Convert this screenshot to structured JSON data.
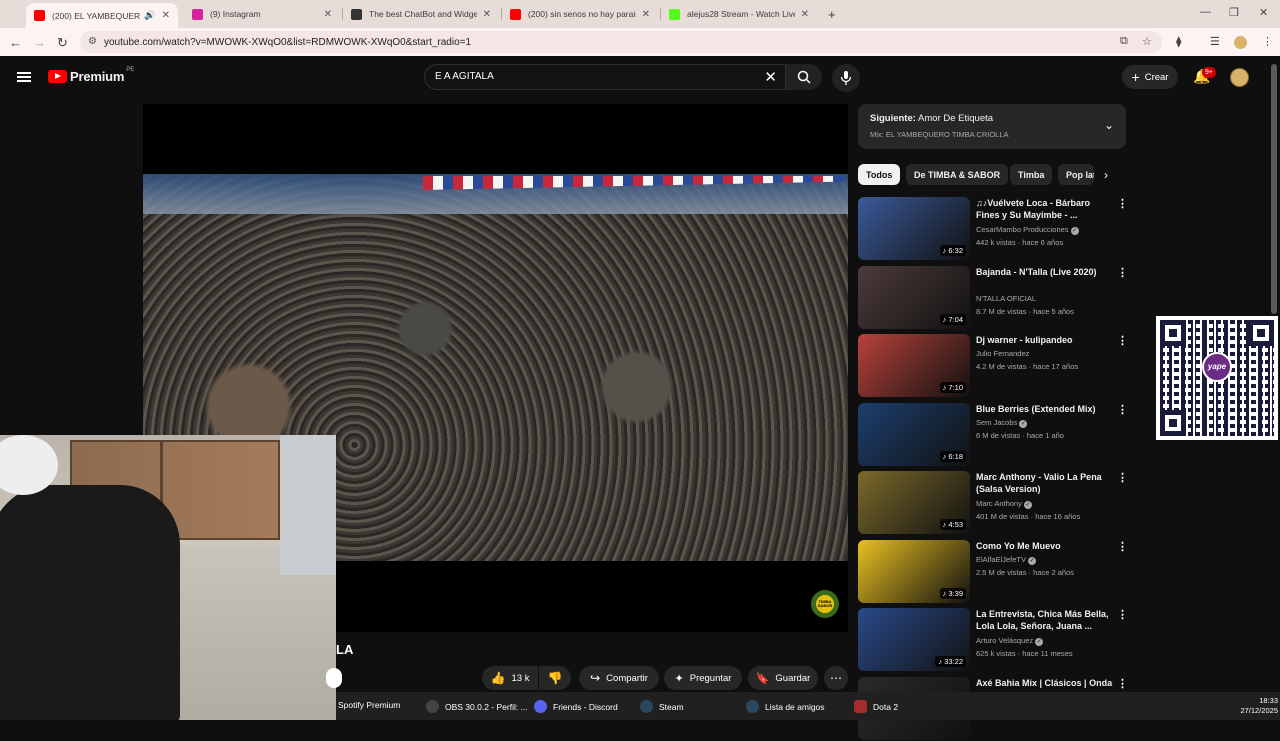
{
  "browser": {
    "tabs": [
      {
        "title": "(200) EL YAMBEQUERO TIMBA CRIOLLA",
        "favicon_color": "#ff0000",
        "active": true
      },
      {
        "title": "(9) Instagram",
        "favicon_color": "#d6249f",
        "active": false
      },
      {
        "title": "The best ChatBot and Widgets",
        "favicon_color": "#333333",
        "active": false
      },
      {
        "title": "(200) sin senos no hay paraiso",
        "favicon_color": "#ff0000",
        "active": false
      },
      {
        "title": "alejus28 Stream - Watch Live on Kick",
        "favicon_color": "#53fc18",
        "active": false
      }
    ],
    "new_tab": "+",
    "url": "youtube.com/watch?v=MWOWK-XWqO0&list=RDMWOWK-XWqO0&start_radio=1"
  },
  "youtube": {
    "logo_text": "Premium",
    "country_code": "PE",
    "search_value": "E A AGITALA",
    "create_label": "Crear",
    "notif_count": "9+",
    "video_title_fragment": "LA",
    "watermark": "TIMBA SABOR",
    "actions": {
      "likes": "13 k",
      "share": "Compartir",
      "ask": "Preguntar",
      "save": "Guardar"
    },
    "up_next": {
      "label": "Siguiente:",
      "title": "Amor De Etiqueta",
      "mix": "Mix: EL YAMBEQUERO TIMBA CRIOLLA"
    },
    "chips": [
      "Todos",
      "De TIMBA & SABOR",
      "Timba",
      "Pop latino"
    ],
    "recommendations": [
      {
        "title": "♫♪Vuélvete Loca - Bárbaro Fines y Su Mayimbe - ...",
        "channel": "CesarMambo Producciones",
        "verified": true,
        "meta": "442 k vistas · hace 6 años",
        "duration": "6:32",
        "thumb_color": "#3a5a9a"
      },
      {
        "title": "Bajanda -  N'Talla (Live 2020)",
        "channel": "N'TALLA OFICIAL",
        "verified": false,
        "meta": "8.7 M de vistas · hace 5 años",
        "duration": "7:04",
        "thumb_color": "#4d3b3a"
      },
      {
        "title": "Dj warner - kulipandeo",
        "channel": "Julio Fernandez",
        "verified": false,
        "meta": "4.2 M de vistas · hace 17 años",
        "duration": "7:10",
        "thumb_color": "#b8423a"
      },
      {
        "title": "Blue Berries (Extended Mix)",
        "channel": "Sem Jacobs",
        "verified": true,
        "meta": "6 M de vistas · hace 1 año",
        "duration": "6:18",
        "thumb_color": "#1c3f6e"
      },
      {
        "title": "Marc Anthony - Valio La Pena (Salsa Version)",
        "channel": "Marc Anthony",
        "verified": true,
        "meta": "401 M de vistas · hace 16 años",
        "duration": "4:53",
        "thumb_color": "#7a6a2a"
      },
      {
        "title": "Como Yo Me Muevo",
        "channel": "ElAlfaElJefeTV",
        "verified": true,
        "meta": "2.5 M de vistas · hace 2 años",
        "duration": "3:39",
        "thumb_color": "#e8c020"
      },
      {
        "title": "La Entrevista, Chica Más Bella, Lola Lola, Señora, Juana ...",
        "channel": "Arturo Velásquez",
        "verified": true,
        "meta": "625 k vistas · hace 11 meses",
        "duration": "33:22",
        "thumb_color": "#2a4a8a"
      },
      {
        "title": "Axé Bahia Mix | Clásicos | Onda",
        "channel": "",
        "verified": false,
        "meta": "",
        "duration": "",
        "thumb_color": "#2a2a2a"
      }
    ]
  },
  "qr_overlay": {
    "brand": "yape"
  },
  "taskbar": {
    "items": [
      {
        "label": "Spotify Premium",
        "color": "#1db954"
      },
      {
        "label": "OBS 30.0.2 - Perfil: ...",
        "color": "#444444"
      },
      {
        "label": "Friends - Discord",
        "color": "#5865f2"
      },
      {
        "label": "Steam",
        "color": "#1b2838"
      },
      {
        "label": "Lista de amigos",
        "color": "#1b2838"
      },
      {
        "label": "Dota 2",
        "color": "#a62c2c"
      }
    ],
    "time": "18:33",
    "date": "27/12/2025"
  }
}
